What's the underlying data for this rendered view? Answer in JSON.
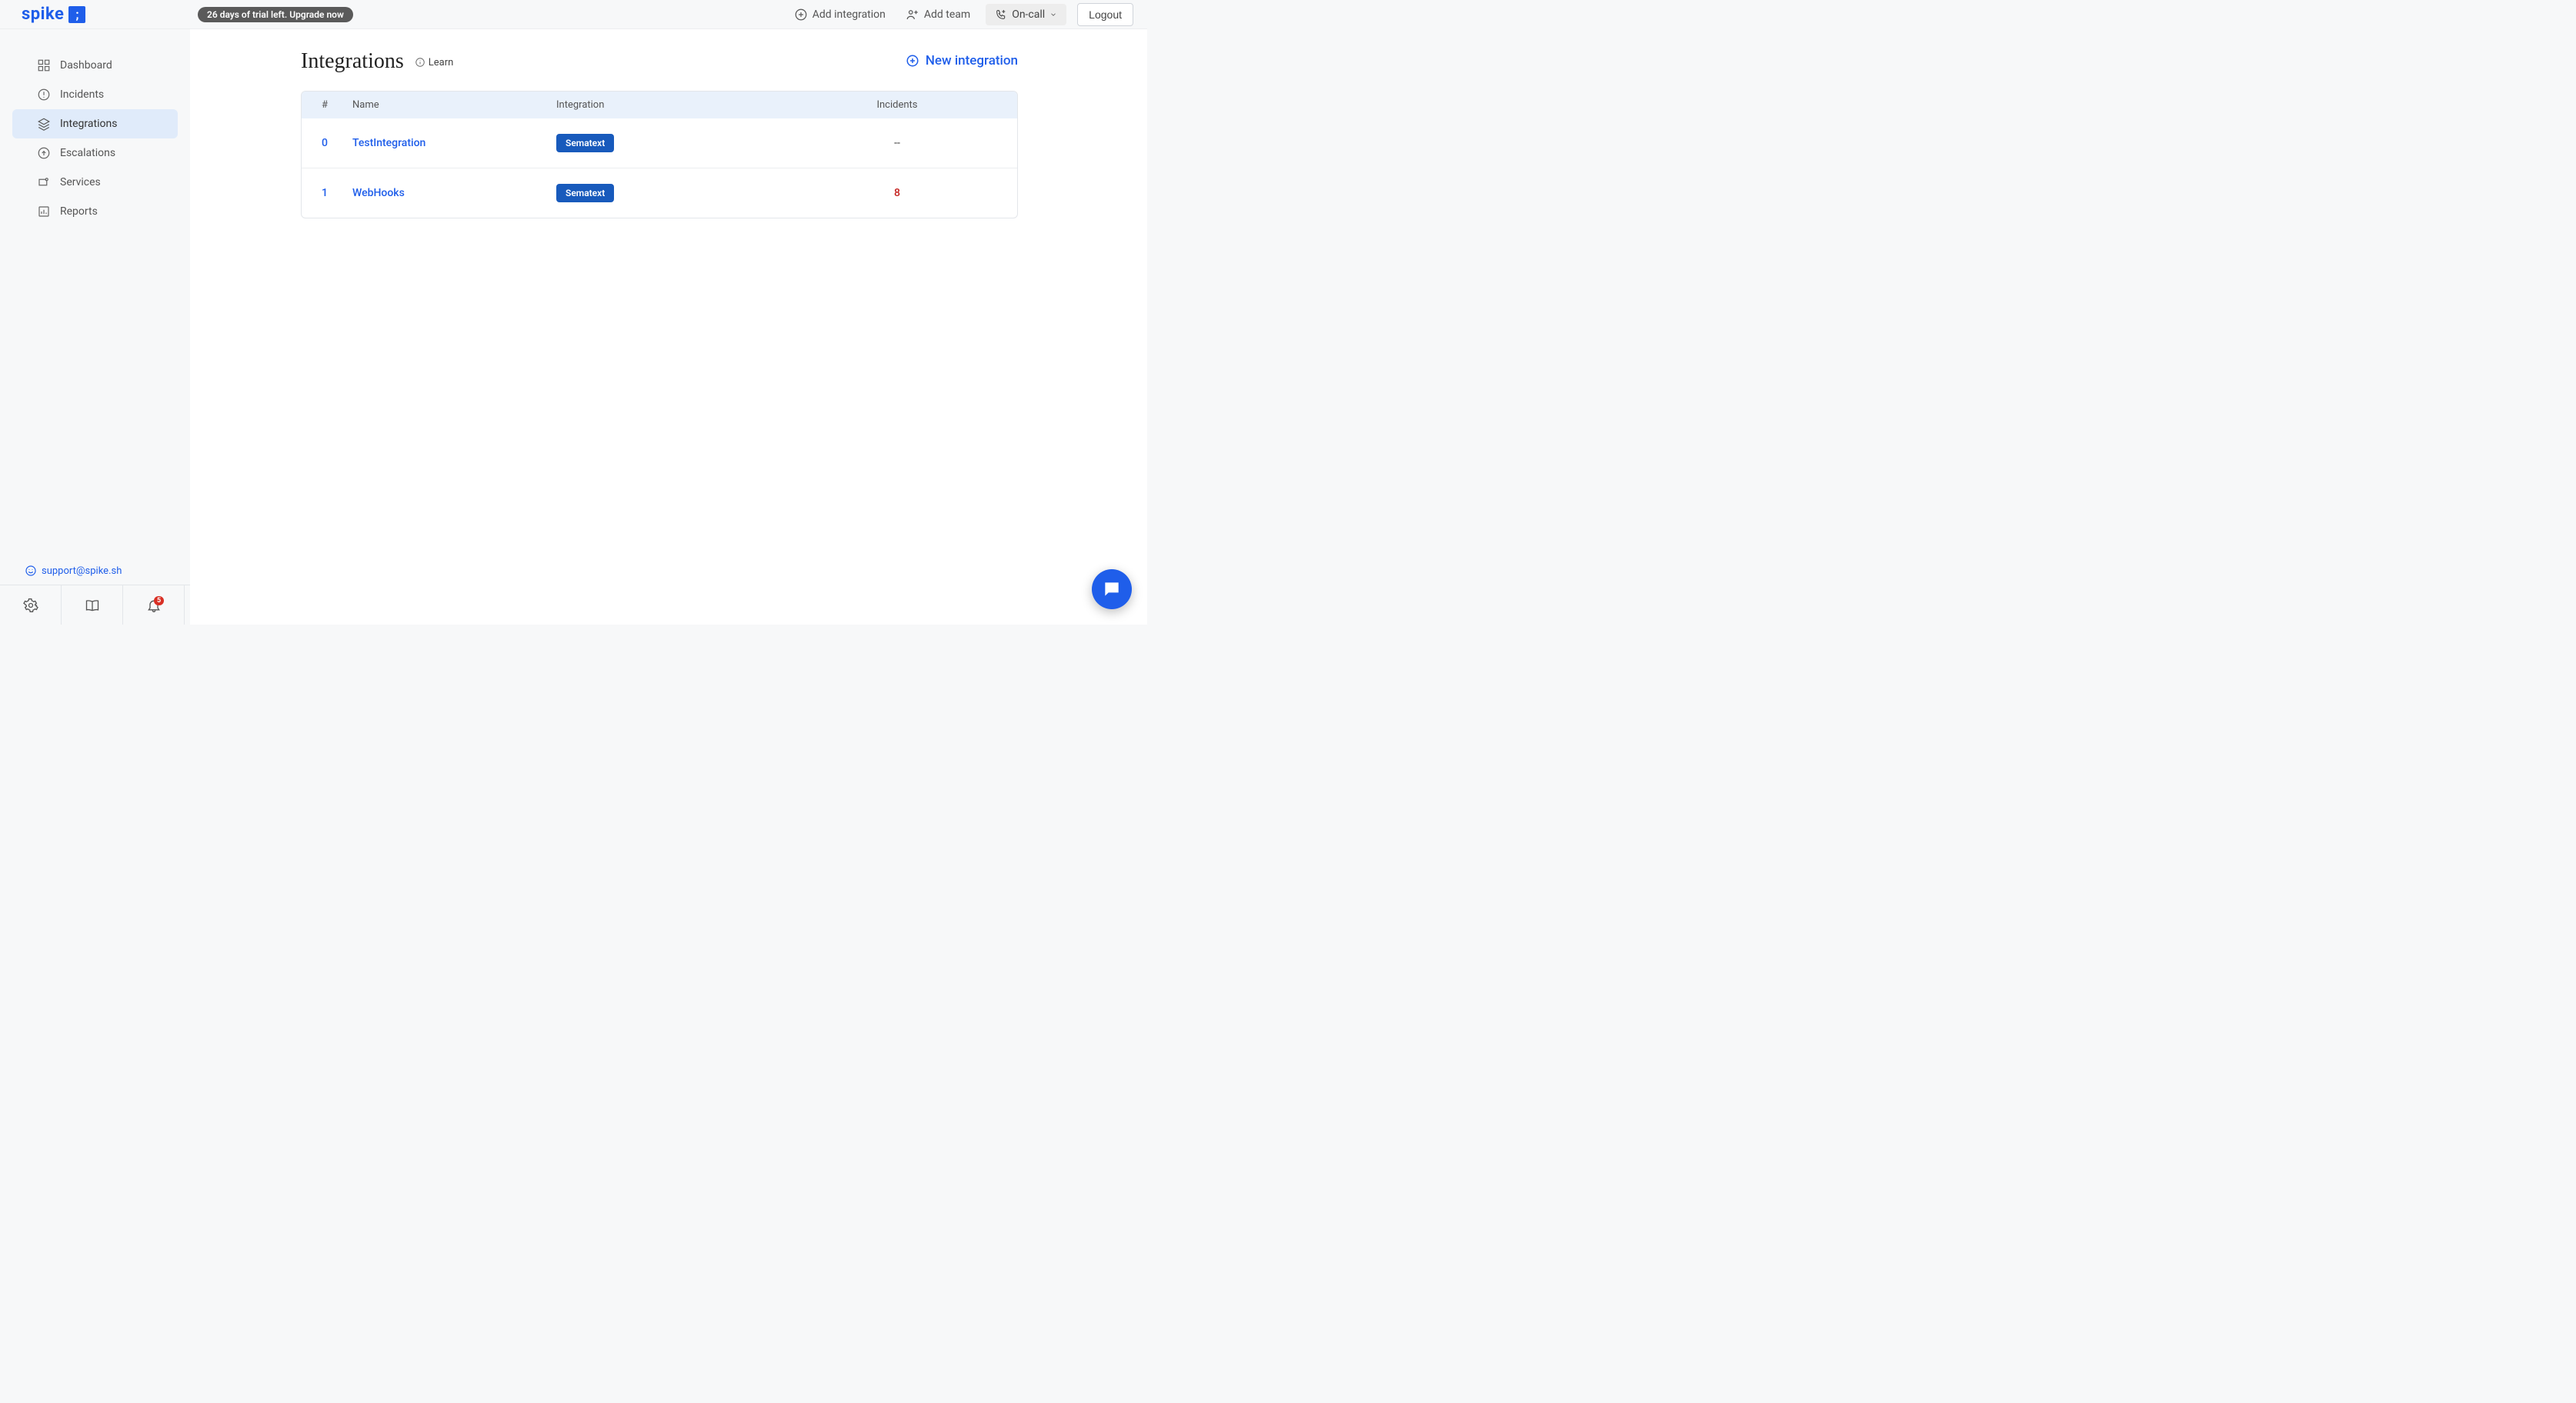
{
  "logo": {
    "text": "spike",
    "mark": ";"
  },
  "topbar": {
    "trial": "26 days of trial left. Upgrade now",
    "add_integration": "Add integration",
    "add_team": "Add team",
    "oncall": "On-call",
    "logout": "Logout"
  },
  "sidebar": {
    "items": [
      {
        "label": "Dashboard"
      },
      {
        "label": "Incidents"
      },
      {
        "label": "Integrations"
      },
      {
        "label": "Escalations"
      },
      {
        "label": "Services"
      },
      {
        "label": "Reports"
      }
    ],
    "support": "support@spike.sh",
    "notif_count": "5"
  },
  "page": {
    "title": "Integrations",
    "learn": "Learn",
    "new_integration": "New integration"
  },
  "table": {
    "headers": {
      "idx": "#",
      "name": "Name",
      "integration": "Integration",
      "incidents": "Incidents"
    },
    "rows": [
      {
        "idx": "0",
        "name": "TestIntegration",
        "integration": "Sematext",
        "incidents": "--",
        "alert": false
      },
      {
        "idx": "1",
        "name": "WebHooks",
        "integration": "Sematext",
        "incidents": "8",
        "alert": true
      }
    ]
  }
}
